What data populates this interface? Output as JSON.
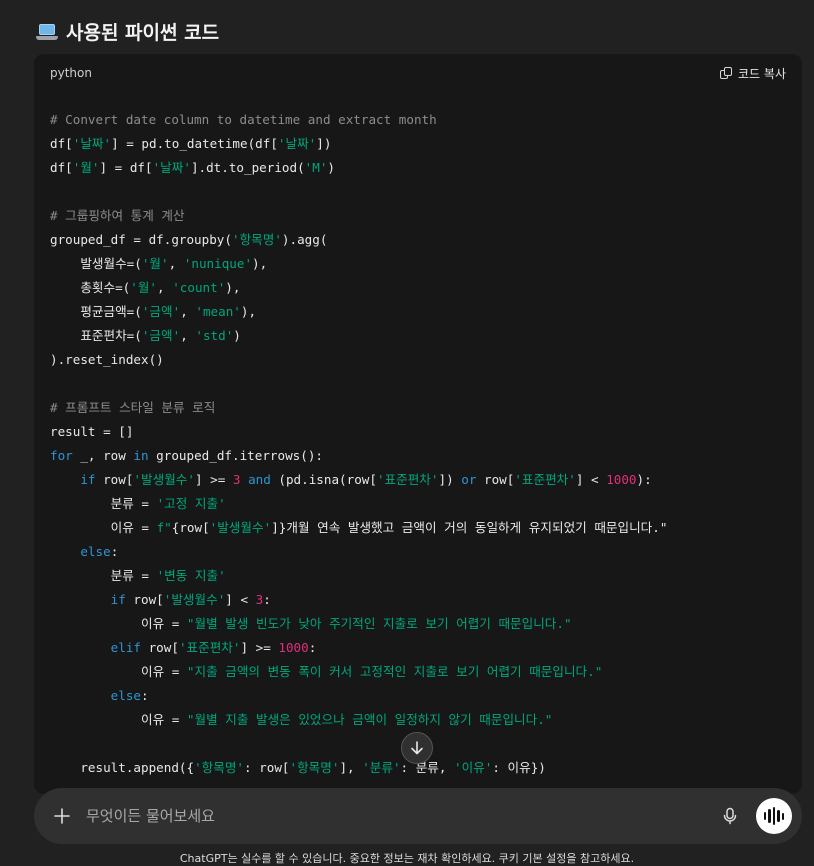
{
  "section": {
    "title": "사용된 파이썬 코드",
    "icon": "laptop-icon"
  },
  "code_block": {
    "language": "python",
    "copy_label": "코드 복사"
  },
  "composer": {
    "placeholder": "무엇이든 물어보세요",
    "plus_icon": "plus-icon",
    "mic_icon": "microphone-icon",
    "voice_icon": "voice-mode-icon"
  },
  "scroll_icon": "arrow-down-icon",
  "footer": {
    "disclaimer": "ChatGPT는 실수를 할 수 있습니다. 중요한 정보는 재차 확인하세요. 쿠키 기본 설정을 참고하세요."
  },
  "colors": {
    "background": "#212121",
    "code_background": "#171717",
    "comment": "#8c8c8c",
    "string": "#00a67d",
    "keyword": "#2e95d3",
    "number": "#df3079"
  }
}
